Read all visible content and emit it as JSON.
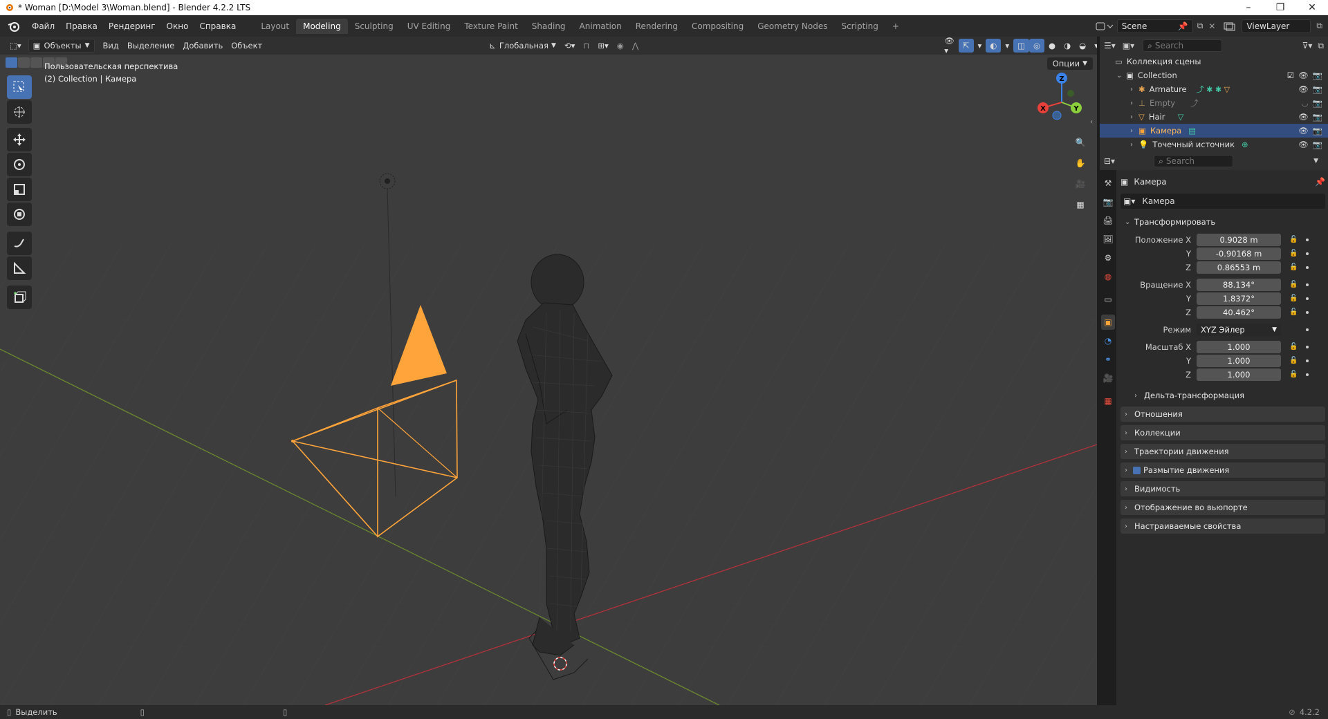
{
  "window": {
    "title": "* Woman [D:\\Model 3\\Woman.blend] - Blender 4.2.2 LTS",
    "controls": [
      "–",
      "❐",
      "✕"
    ]
  },
  "menu": [
    "Файл",
    "Правка",
    "Рендеринг",
    "Окно",
    "Справка"
  ],
  "workspaces": [
    {
      "label": "Layout",
      "active": false
    },
    {
      "label": "Modeling",
      "active": true
    },
    {
      "label": "Sculpting",
      "active": false
    },
    {
      "label": "UV Editing",
      "active": false
    },
    {
      "label": "Texture Paint",
      "active": false
    },
    {
      "label": "Shading",
      "active": false
    },
    {
      "label": "Animation",
      "active": false
    },
    {
      "label": "Rendering",
      "active": false
    },
    {
      "label": "Compositing",
      "active": false
    },
    {
      "label": "Geometry Nodes",
      "active": false
    },
    {
      "label": "Scripting",
      "active": false
    }
  ],
  "add_workspace": "+",
  "scene": {
    "name": "Scene",
    "view_layer": "ViewLayer"
  },
  "viewport": {
    "mode": "Объекты",
    "menus": [
      "Вид",
      "Выделение",
      "Добавить",
      "Объект"
    ],
    "orientation": "Глобальная",
    "overlay_line1": "Пользовательская перспектива",
    "overlay_line2": "(2) Collection | Камера",
    "options": "Опции",
    "gizmo_axes": {
      "x": "X",
      "y": "Y",
      "z": "Z"
    }
  },
  "outliner": {
    "search_placeholder": "Search",
    "scene_collection": "Коллекция сцены",
    "collection": "Collection",
    "items": [
      {
        "name": "Armature",
        "selected": false,
        "dim": false
      },
      {
        "name": "Empty",
        "selected": false,
        "dim": true
      },
      {
        "name": "Hair",
        "selected": false,
        "dim": false
      },
      {
        "name": "Камера",
        "selected": true,
        "dim": false
      },
      {
        "name": "Точечный источник",
        "selected": false,
        "dim": false
      }
    ]
  },
  "properties": {
    "search_placeholder": "Search",
    "object_name": "Камера",
    "object_field": "Камера",
    "transform_title": "Трансформировать",
    "location_label": "Положение X",
    "location": [
      "0.9028 m",
      "-0.90168 m",
      "0.86553 m"
    ],
    "rotation_label": "Вращение X",
    "rotation": [
      "88.134°",
      "1.8372°",
      "40.462°"
    ],
    "mode_label": "Режим",
    "mode_value": "XYZ Эйлер",
    "scale_label": "Масштаб X",
    "scale": [
      "1.000",
      "1.000",
      "1.000"
    ],
    "axis_y": "Y",
    "axis_z": "Z",
    "delta": "Дельта-трансформация",
    "panels": [
      "Отношения",
      "Коллекции",
      "Траектории движения",
      "Размытие движения",
      "Видимость",
      "Отображение во вьюпорте",
      "Настраиваемые свойства"
    ]
  },
  "status": {
    "left": "Выделить",
    "version": "4.2.2"
  },
  "colors": {
    "accent": "#4772b3",
    "selected_object": "#ffa43a",
    "x_axis": "#e8413b",
    "y_axis": "#8ccf3c",
    "z_axis": "#3b82e8"
  }
}
